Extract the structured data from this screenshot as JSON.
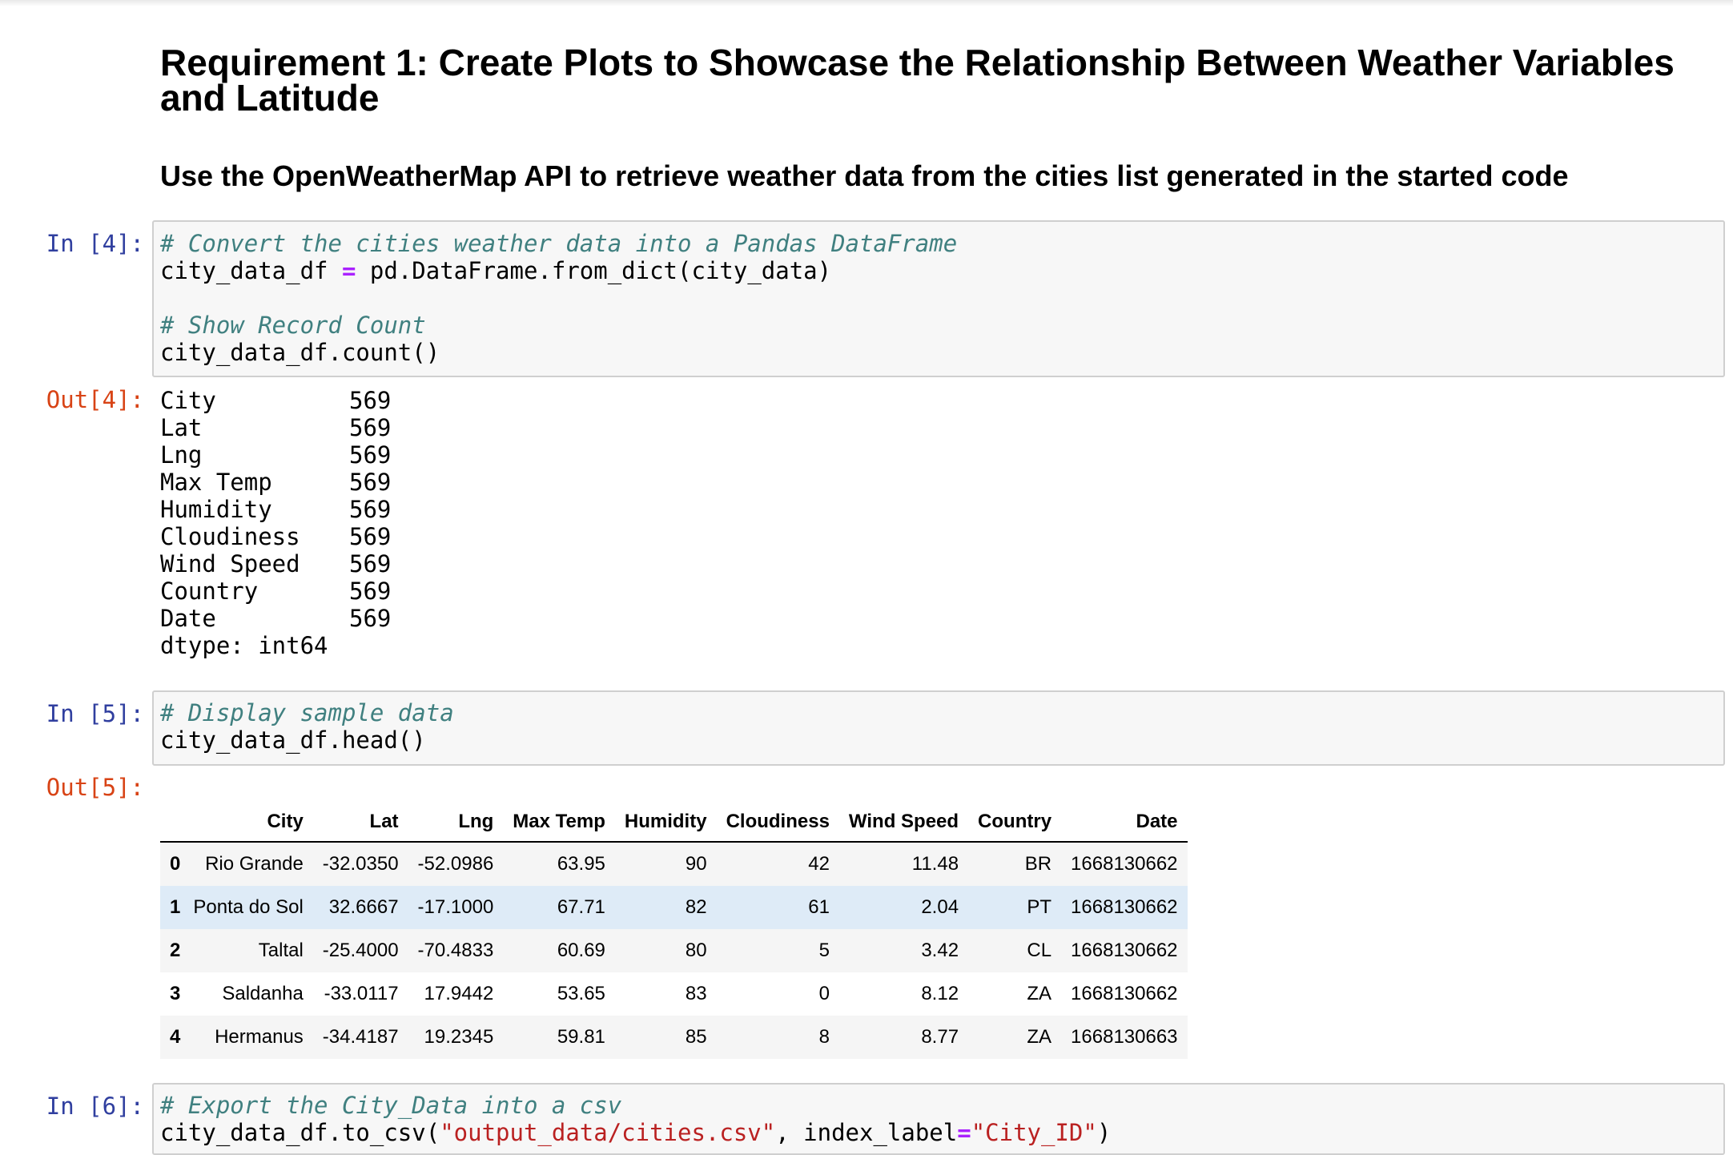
{
  "heading_main": "Requirement 1: Create Plots to Showcase the Relationship Between Weather Variables and Latitude",
  "heading_sub": "Use the OpenWeatherMap API to retrieve weather data from the cities list generated in the started code",
  "cells": {
    "in4": {
      "prompt": "In [4]:",
      "comment1": "# Convert the cities weather data into a Pandas DataFrame",
      "line2_a": "city_data_df ",
      "line2_op": "=",
      "line2_b": " pd.DataFrame.from_dict(city_data)",
      "comment2": "# Show Record Count",
      "line5": "city_data_df.count()"
    },
    "out4": {
      "prompt": "Out[4]:",
      "rows": [
        {
          "key": "City",
          "val": "569"
        },
        {
          "key": "Lat",
          "val": "569"
        },
        {
          "key": "Lng",
          "val": "569"
        },
        {
          "key": "Max Temp",
          "val": "569"
        },
        {
          "key": "Humidity",
          "val": "569"
        },
        {
          "key": "Cloudiness",
          "val": "569"
        },
        {
          "key": "Wind Speed",
          "val": "569"
        },
        {
          "key": "Country",
          "val": "569"
        },
        {
          "key": "Date",
          "val": "569"
        }
      ],
      "dtype": "dtype: int64"
    },
    "in5": {
      "prompt": "In [5]:",
      "comment1": "# Display sample data",
      "line2": "city_data_df.head()"
    },
    "out5": {
      "prompt": "Out[5]:",
      "columns": [
        "",
        "City",
        "Lat",
        "Lng",
        "Max Temp",
        "Humidity",
        "Cloudiness",
        "Wind Speed",
        "Country",
        "Date"
      ],
      "rows": [
        [
          "0",
          "Rio Grande",
          "-32.0350",
          "-52.0986",
          "63.95",
          "90",
          "42",
          "11.48",
          "BR",
          "1668130662"
        ],
        [
          "1",
          "Ponta do Sol",
          "32.6667",
          "-17.1000",
          "67.71",
          "82",
          "61",
          "2.04",
          "PT",
          "1668130662"
        ],
        [
          "2",
          "Taltal",
          "-25.4000",
          "-70.4833",
          "60.69",
          "80",
          "5",
          "3.42",
          "CL",
          "1668130662"
        ],
        [
          "3",
          "Saldanha",
          "-33.0117",
          "17.9442",
          "53.65",
          "83",
          "0",
          "8.12",
          "ZA",
          "1668130662"
        ],
        [
          "4",
          "Hermanus",
          "-34.4187",
          "19.2345",
          "59.81",
          "85",
          "8",
          "8.77",
          "ZA",
          "1668130663"
        ]
      ]
    },
    "in6": {
      "prompt": "In [6]:",
      "comment1": "# Export the City_Data into a csv",
      "line2_a": "city_data_df.to_csv(",
      "line2_s1": "\"output_data/cities.csv\"",
      "line2_b": ", index_label",
      "line2_op": "=",
      "line2_s2": "\"City_ID\"",
      "line2_c": ")"
    }
  }
}
